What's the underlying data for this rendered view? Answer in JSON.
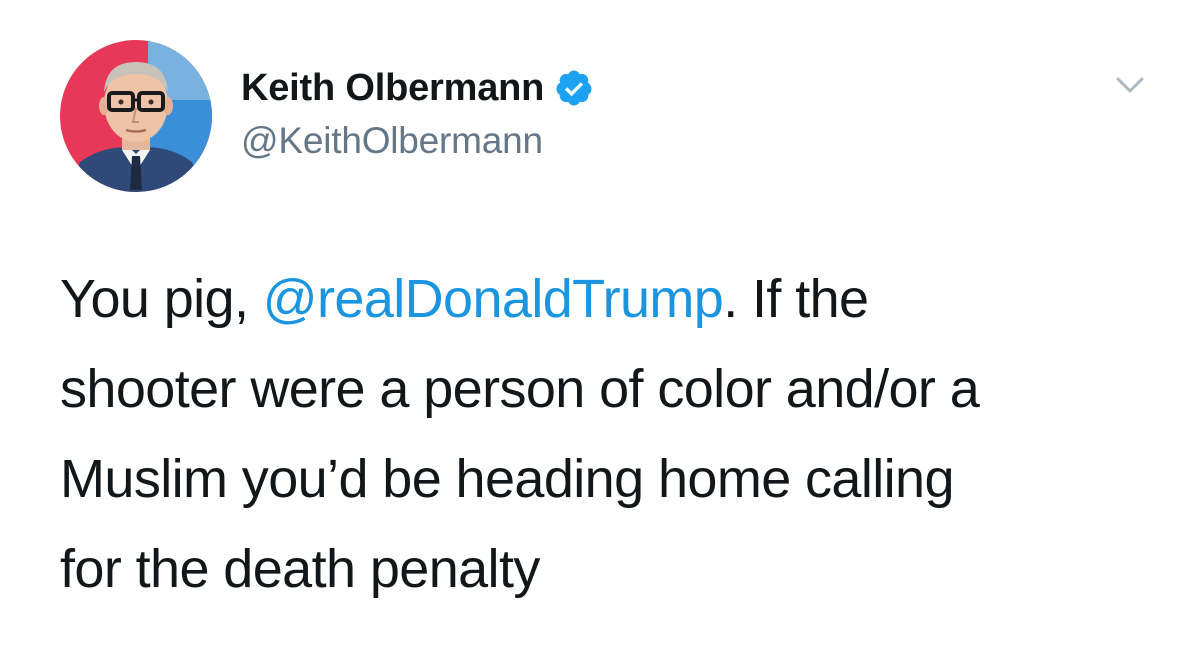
{
  "author": {
    "display_name": "Keith Olbermann",
    "handle": "@KeithOlbermann",
    "verified": true,
    "verified_icon": "verified-badge-icon",
    "avatar_icon": "profile-photo"
  },
  "menu": {
    "icon": "chevron-down-icon"
  },
  "tweet": {
    "line1_pre": "You pig, ",
    "mention": "@realDonaldTrump",
    "line1_post": ". If the",
    "line2": "shooter were a person of color and/or a",
    "line3": "Muslim you’d be heading home calling",
    "line4": "for the death penalty"
  },
  "colors": {
    "text": "#14171a",
    "secondary": "#657786",
    "link": "#1b95e0",
    "verified": "#1da1f2",
    "avatar_bg_red": "#e8385a",
    "avatar_bg_blue": "#3a8fd8"
  }
}
